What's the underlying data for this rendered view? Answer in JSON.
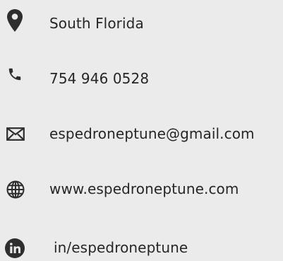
{
  "contact": {
    "location": "South Florida",
    "phone": "754 946 0528",
    "email": "espedroneptune@gmail.com",
    "website": "www.espedroneptune.com",
    "linkedin": "in/espedroneptune"
  },
  "icons": {
    "location": "map-pin-icon",
    "phone": "phone-icon",
    "email": "envelope-icon",
    "website": "globe-icon",
    "linkedin": "linkedin-icon"
  },
  "colors": {
    "background": "#ebebeb",
    "icon": "#2e2e2e",
    "text": "#262626"
  }
}
